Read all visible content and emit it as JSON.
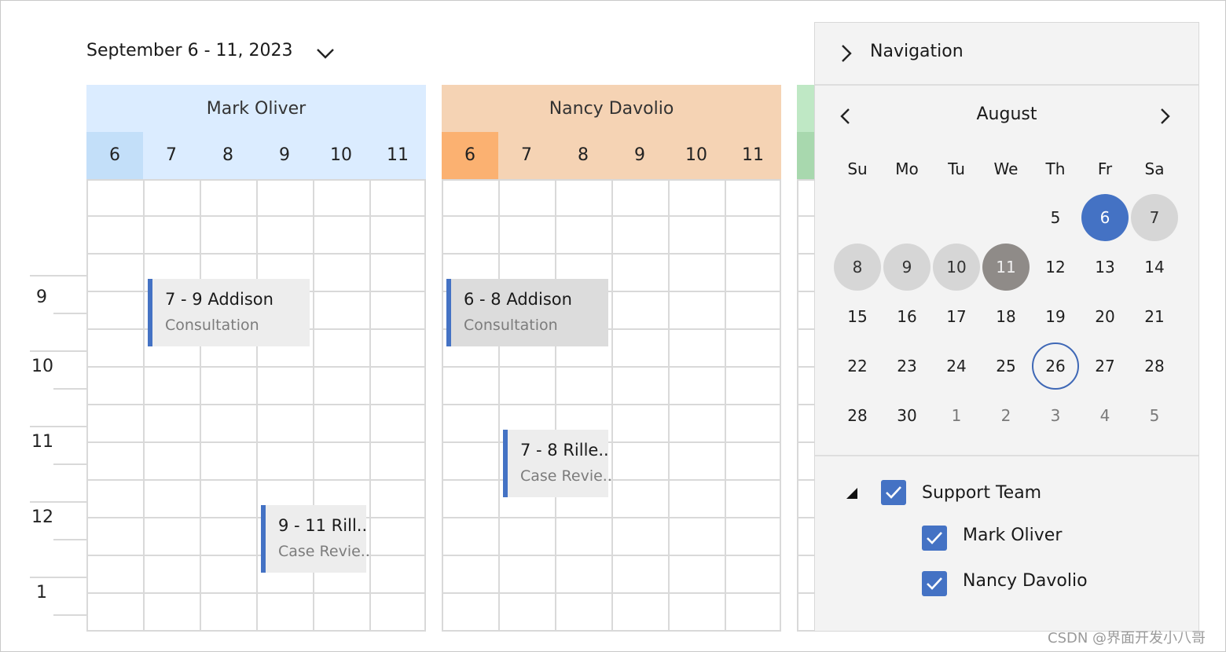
{
  "header": {
    "date_range": "September 6 - 11, 2023"
  },
  "resources": [
    {
      "name": "Mark Oliver",
      "color": "#dbecff",
      "active_day_color": "#c3dff9",
      "days": [
        "6",
        "7",
        "8",
        "9",
        "10",
        "11"
      ]
    },
    {
      "name": "Nancy Davolio",
      "color": "#f5d3b4",
      "active_day_color": "#fbb171",
      "days": [
        "6",
        "7",
        "8",
        "9",
        "10",
        "11"
      ]
    }
  ],
  "third_resource_color": "#bfe8c5",
  "third_resource_day_color": "#a8d8ae",
  "time_labels": [
    "9",
    "10",
    "11",
    "12",
    "1"
  ],
  "appointments": [
    {
      "title": "7 - 9 Addison",
      "subject": "Consultation"
    },
    {
      "title": "9 - 11 Rill..",
      "subject": "Case Revie.."
    },
    {
      "title": "6 - 8 Addison",
      "subject": "Consultation"
    },
    {
      "title": "7 - 8 Rille..",
      "subject": "Case Revie.."
    }
  ],
  "navigation": {
    "title": "Navigation",
    "month": "August",
    "weekdays": [
      "Su",
      "Mo",
      "Tu",
      "We",
      "Th",
      "Fr",
      "Sa"
    ],
    "weeks": [
      [
        "",
        "",
        "",
        "",
        "5",
        "6",
        "7"
      ],
      [
        "8",
        "9",
        "10",
        "11",
        "12",
        "13",
        "14"
      ],
      [
        "15",
        "16",
        "17",
        "18",
        "19",
        "20",
        "21"
      ],
      [
        "22",
        "23",
        "24",
        "25",
        "26",
        "27",
        "28"
      ],
      [
        "28",
        "30",
        "1",
        "2",
        "3",
        "4",
        "5"
      ]
    ],
    "tree": {
      "group": "Support Team",
      "members": [
        "Mark Oliver",
        "Nancy Davolio"
      ]
    }
  },
  "watermark": "CSDN @界面开发小八哥"
}
